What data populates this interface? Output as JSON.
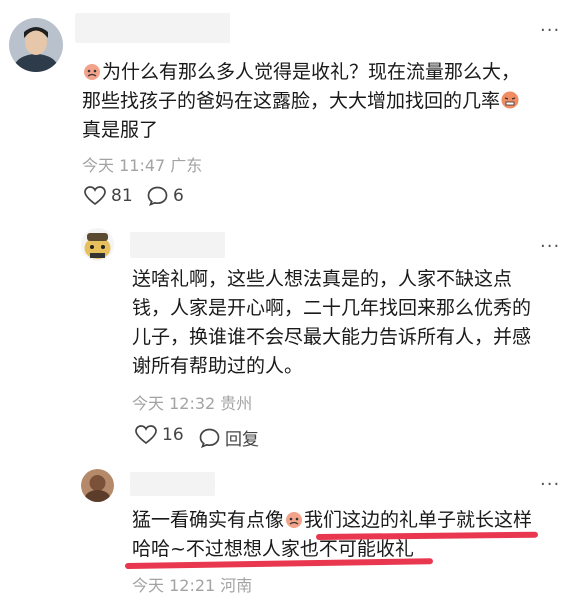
{
  "comments": [
    {
      "text_before_emoji": "为什么有那么多人觉得是收礼？现在流量那么大，",
      "line2": "那些找孩子的爸妈在这露脸，大大增加找回的几率",
      "line3": "真是服了",
      "time": "今天 11:47 广东",
      "likes": "81",
      "replies": "6"
    },
    {
      "lines": [
        "送啥礼啊，这些人想法真是的，人家不缺这点",
        "钱，人家是开心啊，二十几年找回来那么优秀的",
        "儿子，换谁谁不会尽最大能力告诉所有人，并感",
        "谢所有帮助过的人。"
      ],
      "time": "今天 12:32 贵州",
      "likes": "16",
      "reply_label": "回复"
    },
    {
      "part1": "猛一看确实有点像",
      "part2": "我们这边的礼单子就长这样",
      "line2": "哈哈~不过想想人家也不可能收礼",
      "time_partial": "今天 12:21 河南"
    }
  ],
  "icons": [
    "more-icon",
    "heart-icon",
    "comment-icon",
    "emoji-icon"
  ],
  "colors": {
    "underline": "#e8374f",
    "meta": "#a3a3a3",
    "text": "#1a1a1a"
  }
}
